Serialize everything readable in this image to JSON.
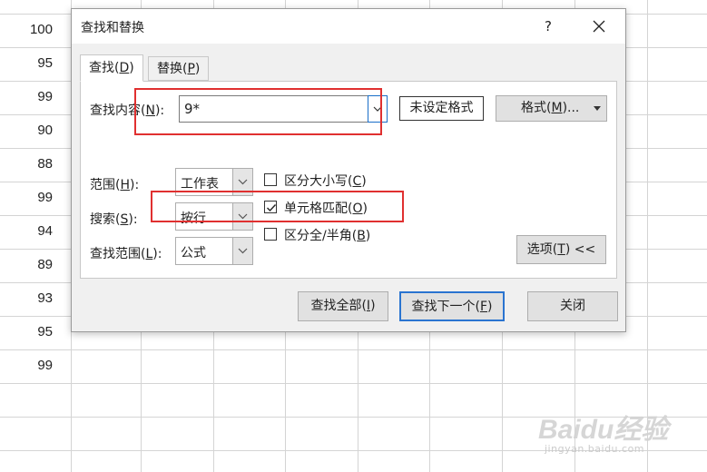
{
  "sheet": {
    "cells": [
      "100",
      "95",
      "99",
      "90",
      "88",
      "99",
      "94",
      "89",
      "93",
      "95",
      "99"
    ]
  },
  "dialog": {
    "title": "查找和替换",
    "help": "?",
    "tabs": [
      {
        "label": "查找",
        "key": "D"
      },
      {
        "label": "替换",
        "key": "P"
      }
    ],
    "find": {
      "label": "查找内容",
      "key": "N",
      "value": "9*"
    },
    "no_format_label": "未设定格式",
    "format_button": {
      "label": "格式",
      "key": "M",
      "suffix": "..."
    },
    "scope": {
      "label": "范围",
      "key": "H",
      "value": "工作表"
    },
    "search": {
      "label": "搜索",
      "key": "S",
      "value": "按行"
    },
    "look_in": {
      "label": "查找范围",
      "key": "L",
      "value": "公式"
    },
    "checkboxes": [
      {
        "label": "区分大小写",
        "key": "C",
        "checked": false
      },
      {
        "label": "单元格匹配",
        "key": "O",
        "checked": true
      },
      {
        "label": "区分全/半角",
        "key": "B",
        "checked": false
      }
    ],
    "options_button": {
      "label": "选项",
      "key": "T",
      "suffix": " <<"
    },
    "find_all_button": {
      "label": "查找全部",
      "key": "I"
    },
    "find_next_button": {
      "label": "查找下一个",
      "key": "F"
    },
    "close_button": "关闭"
  },
  "watermark": {
    "main": "Baidu经验",
    "sub": "jingyan.baidu.com"
  },
  "colors": {
    "highlight": "#e03030",
    "focus": "#2a74d0",
    "dialog_bg": "#f0f0f0"
  }
}
